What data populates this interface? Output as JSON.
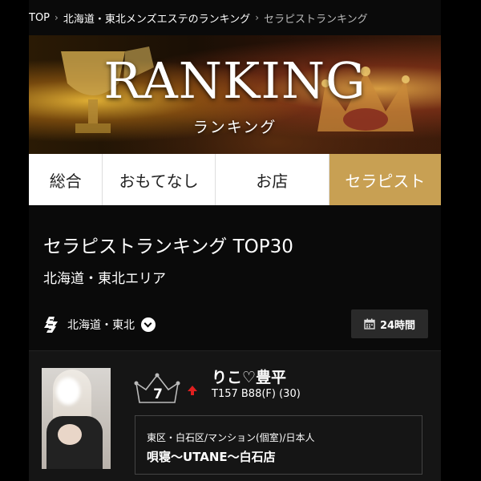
{
  "breadcrumb": [
    {
      "label": "TOP"
    },
    {
      "label": "北海道・東北メンズエステのランキング"
    },
    {
      "label": "セラピストランキング"
    }
  ],
  "banner": {
    "title": "RANKING",
    "subtitle": "ランキング"
  },
  "tabs": [
    {
      "label": "総合",
      "active": false
    },
    {
      "label": "おもてなし",
      "active": false
    },
    {
      "label": "お店",
      "active": false
    },
    {
      "label": "セラピスト",
      "active": true
    }
  ],
  "heading": {
    "title": "セラピストランキング TOP30",
    "subtitle": "北海道・東北エリア"
  },
  "filters": {
    "area": "北海道・東北",
    "area_icon": "area-map-icon",
    "period": "24時間",
    "period_icon": "calendar-icon"
  },
  "ranking": [
    {
      "rank": "7",
      "trend": "up",
      "name": "りこ♡豊平",
      "stats": "T157 B88(F) (30)",
      "shop_meta": "東区・白石区/マンション(個室)/日本人",
      "shop_name": "唄寝〜UTANE〜白石店"
    }
  ],
  "colors": {
    "accent_gold": "#c8a053",
    "trend_up": "#e02020",
    "background": "#000000"
  }
}
